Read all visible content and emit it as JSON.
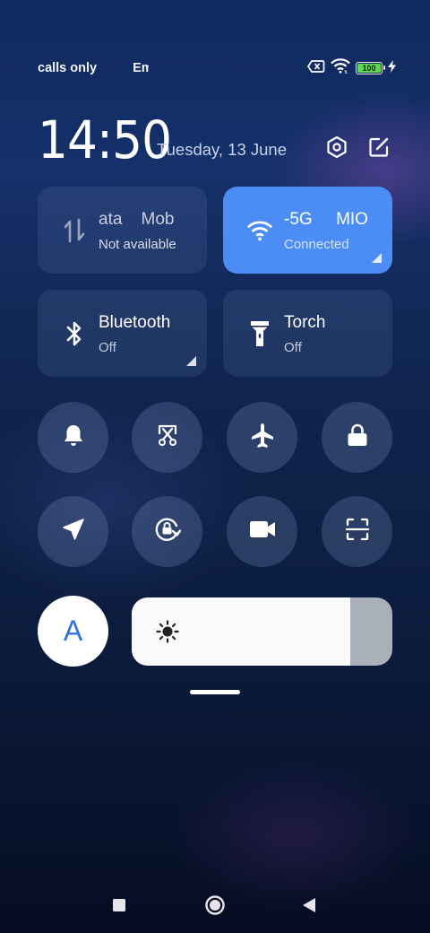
{
  "status": {
    "left_text_1": "calls only",
    "left_text_2": "Em",
    "battery": "100",
    "icons": [
      "sim-off-icon",
      "wifi-icon",
      "battery-icon",
      "charging-icon"
    ]
  },
  "header": {
    "time": "14:50",
    "date": "Tuesday, 13 June",
    "icons": [
      "settings-icon",
      "edit-icon"
    ]
  },
  "tiles": [
    {
      "title": "ata    Mob",
      "subtitle": "Not available",
      "icon": "mobile-data-icon",
      "active": false
    },
    {
      "title": "-5G     MIO",
      "subtitle": "Connected",
      "icon": "wifi-icon",
      "active": true
    },
    {
      "title": "Bluetooth",
      "subtitle": "Off",
      "icon": "bluetooth-icon",
      "active": false
    },
    {
      "title": "Torch",
      "subtitle": "Off",
      "icon": "torch-icon",
      "active": false
    }
  ],
  "toggles": [
    "bell-icon",
    "screenshot-icon",
    "airplane-icon",
    "lock-icon",
    "location-icon",
    "rotation-lock-icon",
    "video-icon",
    "scan-icon"
  ],
  "brightness": {
    "auto_label": "A",
    "level": 0.84
  },
  "colors": {
    "accent": "#4b8cf5",
    "auto_text": "#2b73e8"
  },
  "nav": [
    "recents-icon",
    "home-icon",
    "back-icon"
  ]
}
